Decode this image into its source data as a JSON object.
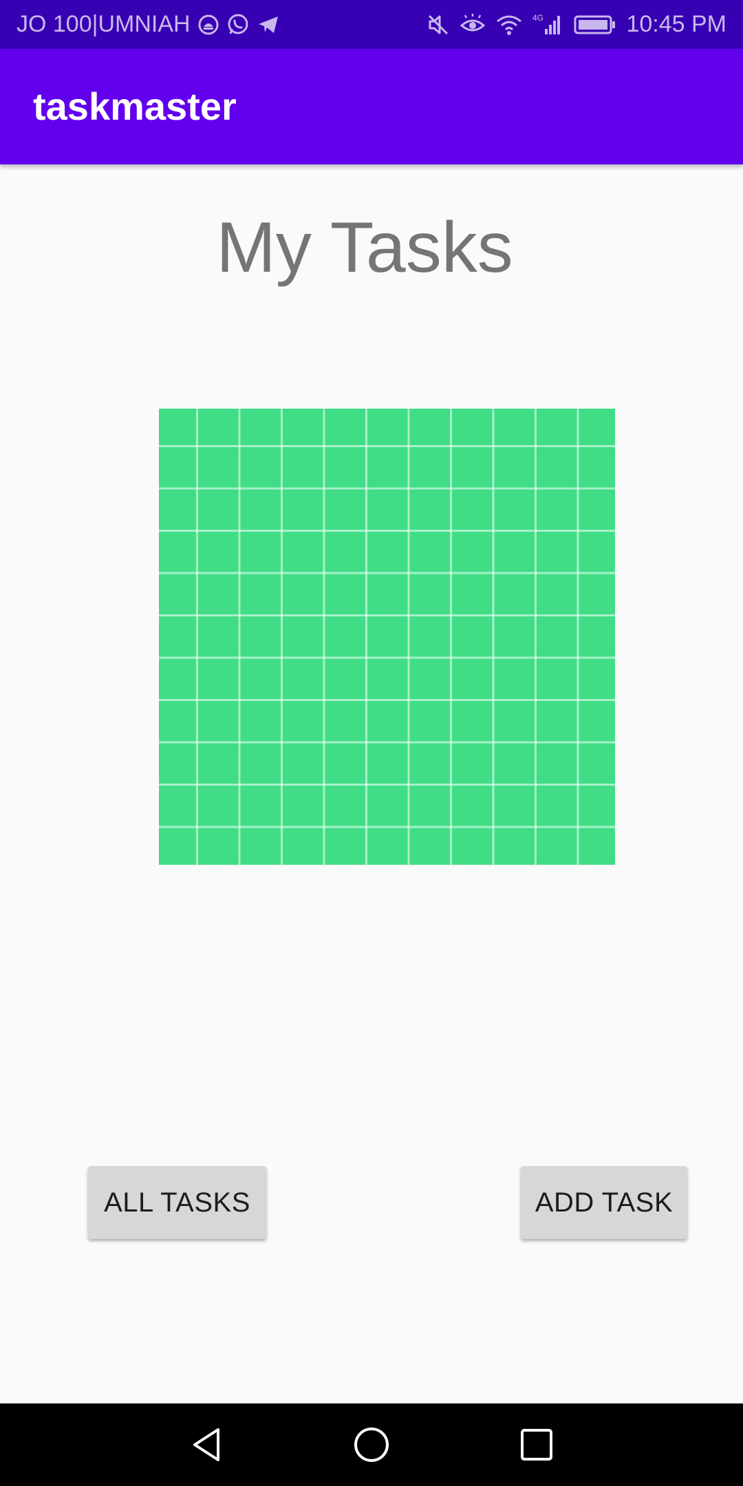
{
  "status_bar": {
    "carrier": "JO 100|UMNIAH",
    "time": "10:45 PM",
    "left_icons": [
      "app-notification-icon",
      "whatsapp-icon",
      "telegram-icon"
    ],
    "right_icons": [
      "mute-icon",
      "eye-comfort-icon",
      "wifi-icon",
      "signal-4g-icon",
      "battery-icon"
    ],
    "network_label": "4G"
  },
  "app_bar": {
    "title": "taskmaster"
  },
  "main": {
    "heading": "My Tasks",
    "image": "grid-image"
  },
  "buttons": {
    "all_tasks": "ALL TASKS",
    "add_task": "ADD TASK"
  },
  "nav_bar": {
    "icons": [
      "back-icon",
      "home-icon",
      "recents-icon"
    ]
  },
  "colors": {
    "status_bar": "#3700b3",
    "app_bar": "#6200ee",
    "grid_image": "#40dc86",
    "button": "#d6d7d7",
    "heading_text": "#757575"
  }
}
